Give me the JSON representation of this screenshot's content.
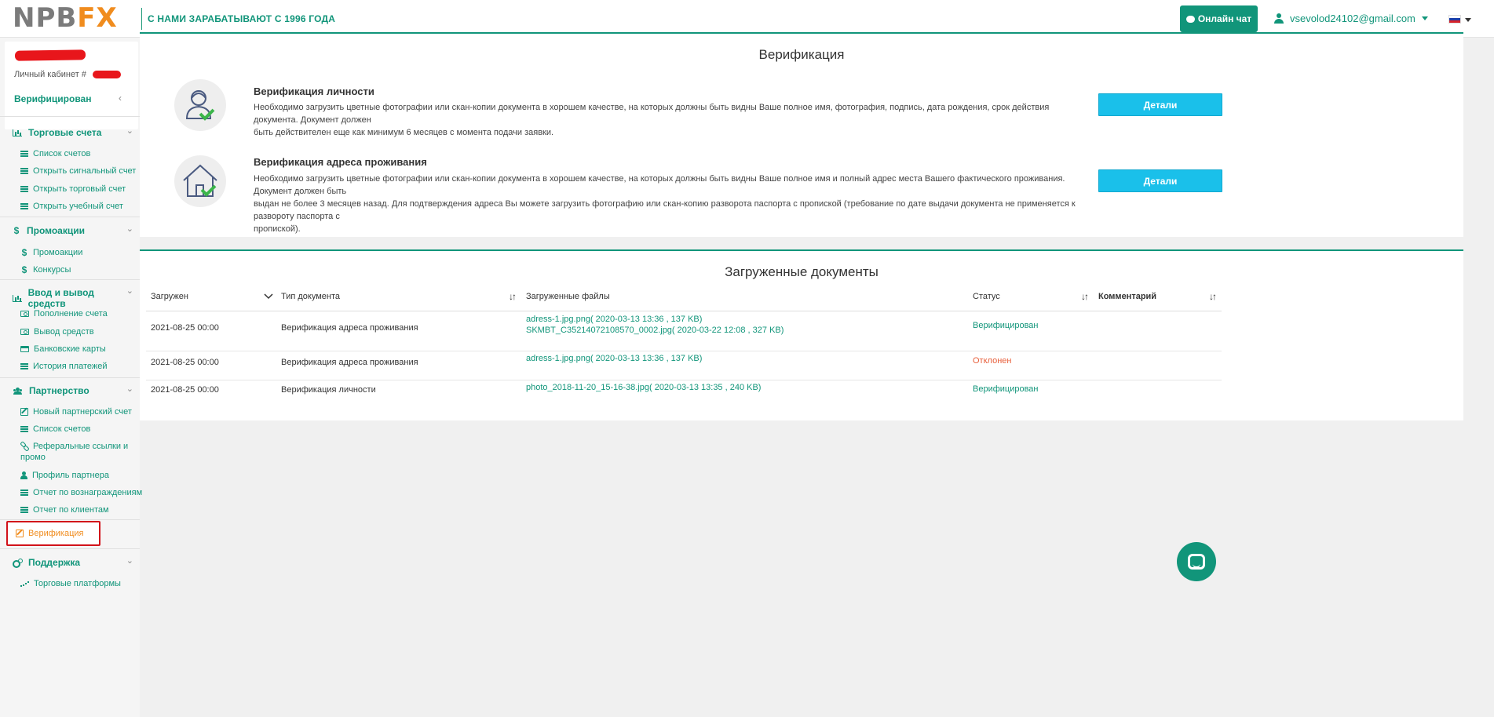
{
  "header": {
    "logo_main": "NPB",
    "logo_accent": "FX",
    "slogan": "С НАМИ ЗАРАБАТЫВАЮТ С 1996 ГОДА",
    "chat_button": "Онлайн чат",
    "user_email": "vsevolod24102@gmail.com",
    "language_flag": "ru"
  },
  "profile": {
    "cabinet_label": "Личный кабинет #",
    "status": "Верифицирован"
  },
  "sidebar": {
    "groups": [
      {
        "label": "Торговые счета",
        "icon": "bar-chart-icon",
        "items": [
          "Список счетов",
          "Открыть сигнальный счет",
          "Открыть торговый счет",
          "Открыть учебный счет"
        ]
      },
      {
        "label": "Промоакции",
        "icon": "dollar-icon",
        "items": [
          "Промоакции",
          "Конкурсы"
        ]
      },
      {
        "label": "Ввод и вывод средств",
        "icon": "bar-chart-icon",
        "items": [
          "Пополнение счета",
          "Вывод средств",
          "Банковские карты",
          "История платежей"
        ]
      },
      {
        "label": "Партнерство",
        "icon": "users-icon",
        "items": [
          "Новый партнерский счет",
          "Список счетов",
          "Реферальные ссылки и",
          "промо",
          "Профиль партнера",
          "Отчет по вознаграждениям",
          "Отчет по клиентам"
        ]
      },
      {
        "label": "Поддержка",
        "icon": "gears-icon",
        "items": [
          "Торговые платформы"
        ]
      }
    ],
    "active_item": "Верификация"
  },
  "verification": {
    "title": "Верификация",
    "identity": {
      "title": "Верификация личности",
      "desc_line1": "Необходимо загрузить цветные фотографии или скан-копии документа в хорошем качестве, на которых должны быть видны Ваше полное имя, фотография, подпись, дата рождения, срок действия документа. Документ должен",
      "desc_line2": "быть действителен еще как минимум 6 месяцев с момента подачи заявки.",
      "button": "Детали"
    },
    "address": {
      "title": "Верификация адреса проживания",
      "desc_line1": "Необходимо загрузить цветные фотографии или скан-копии документа в хорошем качестве, на которых должны быть видны Ваше полное имя и полный адрес места Вашего фактического проживания. Документ должен быть",
      "desc_line2": "выдан не более 3 месяцев назад. Для подтверждения адреса Вы можете загрузить фотографию или скан-копию разворота паспорта с пропиской (требование по дате выдачи документа не применяется к развороту паспорта с",
      "desc_line3": "пропиской).",
      "button": "Детали"
    }
  },
  "documents": {
    "title": "Загруженные документы",
    "columns": [
      "Загружен",
      "Тип документа",
      "Загруженные файлы",
      "Статус",
      "Комментарий"
    ],
    "rows": [
      {
        "date": "2021-08-25 00:00",
        "type": "Верификация адреса проживания",
        "files": [
          "adress-1.jpg.png( 2020-03-13 13:36 , 137 KB)",
          "SKMBT_C35214072108570_0002.jpg( 2020-03-22 12:08 , 327 KB)"
        ],
        "status": "Верифицирован",
        "comment": ""
      },
      {
        "date": "2021-08-25 00:00",
        "type": "Верификация адреса проживания",
        "files": [
          "adress-1.jpg.png( 2020-03-13 13:36 , 137 KB)"
        ],
        "status": "Отклонен",
        "comment": ""
      },
      {
        "date": "2021-08-25 00:00",
        "type": "Верификация личности",
        "files": [
          "photo_2018-11-20_15-16-38.jpg( 2020-03-13 13:35 , 240 KB)"
        ],
        "status": "Верифицирован",
        "comment": ""
      }
    ]
  },
  "colors": {
    "brand": "#11957a",
    "accent": "#f08c1e",
    "button": "#1ac0ea",
    "rejected": "#e8603c"
  }
}
